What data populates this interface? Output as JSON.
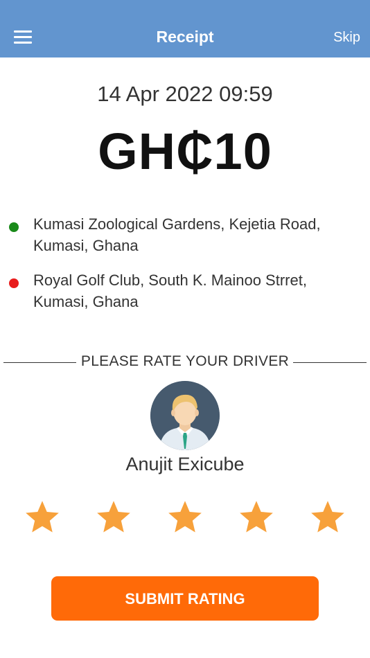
{
  "header": {
    "title": "Receipt",
    "skip_label": "Skip",
    "background_color": "#6295cf"
  },
  "receipt": {
    "datetime": "14 Apr 2022 09:59",
    "fare": "GH₵10"
  },
  "route": {
    "pickup": {
      "line1": "Kumasi Zoological Gardens, Kejetia Road,",
      "line2": "Kumasi, Ghana",
      "dot_color": "#1a8a1a"
    },
    "dropoff": {
      "line1": "Royal Golf Club, South K. Mainoo Strret,",
      "line2": "Kumasi, Ghana",
      "dot_color": "#e81c1c"
    }
  },
  "rating": {
    "prompt": "PLEASE RATE YOUR DRIVER",
    "driver_name": "Anujit Exicube",
    "stars_total": 5,
    "stars_selected": 5,
    "star_color": "#f7a13b",
    "submit_label": "SUBMIT RATING",
    "submit_color": "#ff6a08"
  }
}
